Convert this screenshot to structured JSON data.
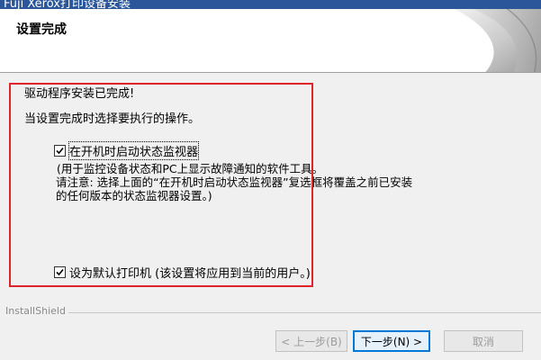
{
  "window": {
    "title": "Fuji Xerox打印设备安装"
  },
  "header": {
    "heading": "设置完成"
  },
  "content": {
    "line1": "驱动程序安装已完成!",
    "line2": "当设置完成时选择要执行的操作。",
    "status_monitor": {
      "checked": true,
      "label": "在开机时启动状态监视器",
      "desc1": "(用于监控设备状态和PC上显示故障通知的软件工具。",
      "desc2": "请注意: 选择上面的“在开机时启动状态监视器”复选框将覆盖之前已安装",
      "desc3": "的任何版本的状态监视器设置。)"
    },
    "default_printer": {
      "checked": true,
      "label": "设为默认打印机 (该设置将应用到当前的用户。)"
    }
  },
  "footer": {
    "brand": "InstallShield"
  },
  "buttons": {
    "back": "< 上一步(B)",
    "next": "下一步(N) >",
    "cancel": "取消"
  },
  "colors": {
    "highlight": "#e0242b",
    "primary_border": "#0078d7"
  }
}
